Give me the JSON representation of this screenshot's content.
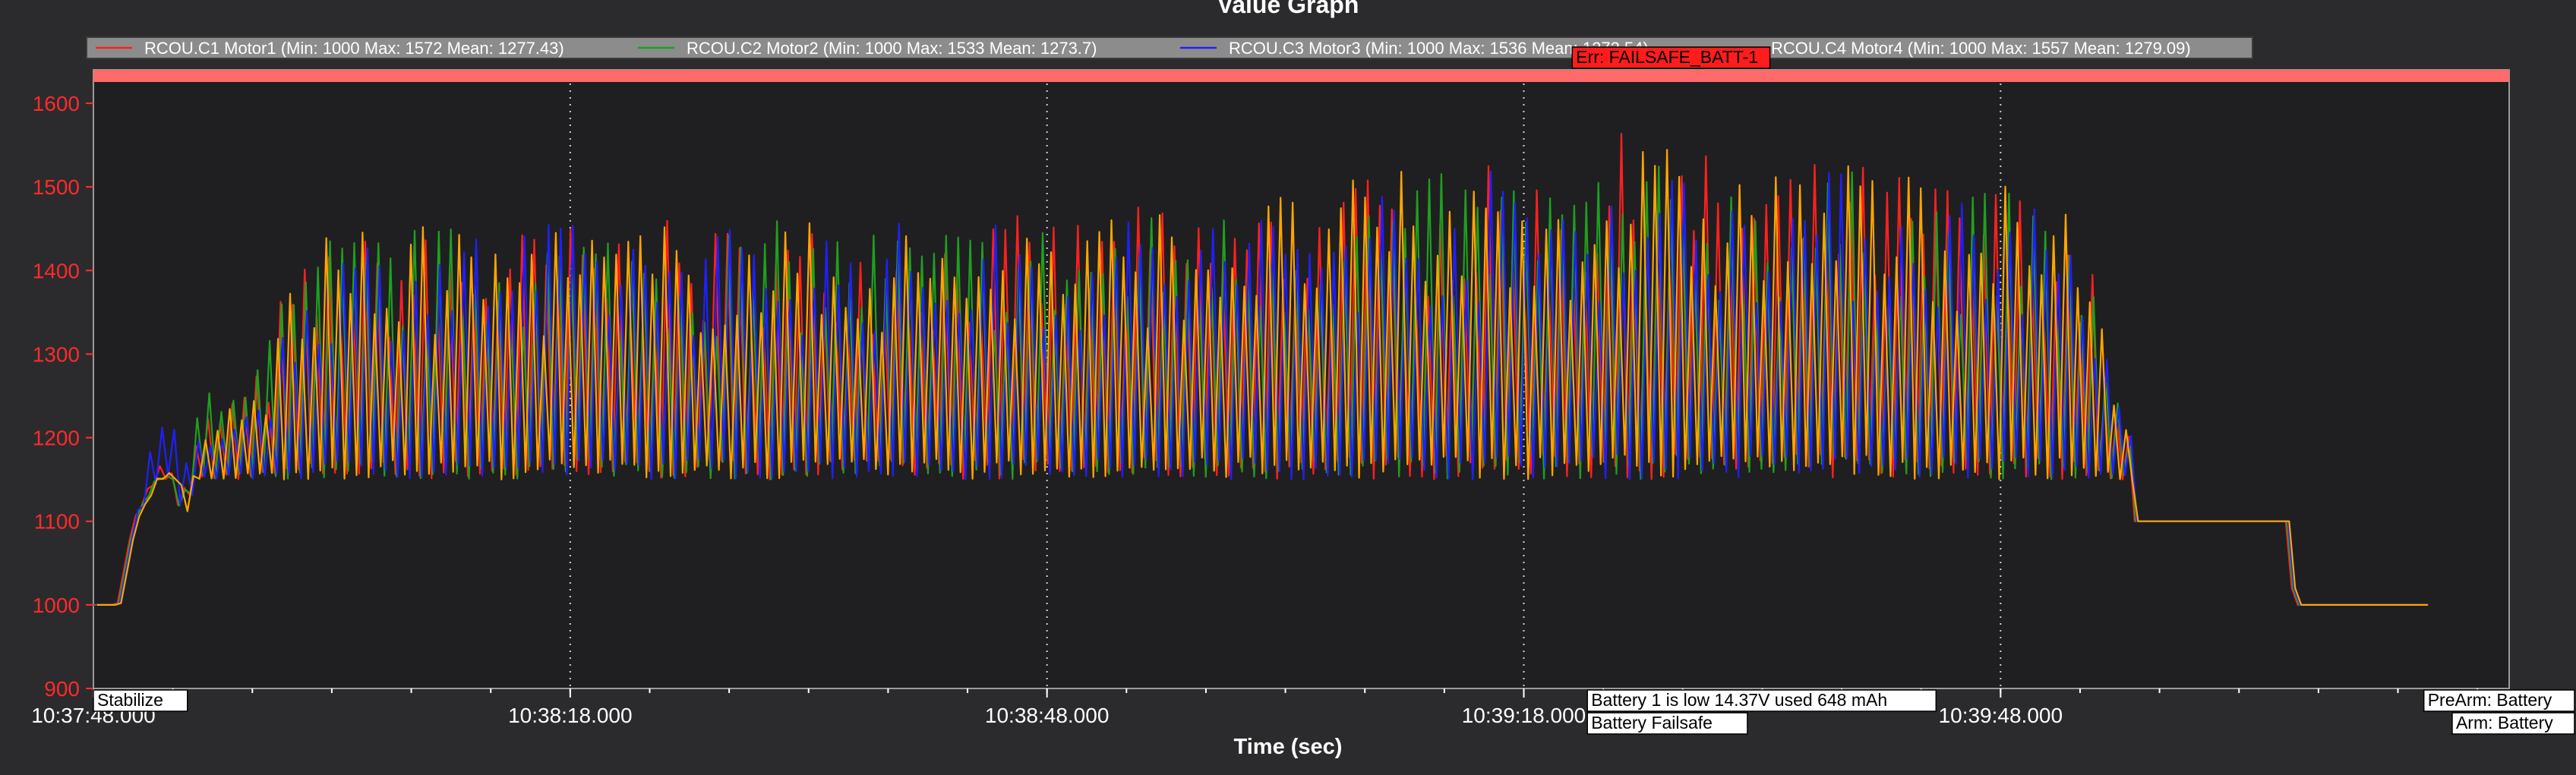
{
  "window": {
    "title": "Value Graph"
  },
  "chart_data": {
    "type": "line",
    "title": "Value Graph",
    "xlabel": "Time (sec)",
    "ylabel": "",
    "x_unit": "time of day",
    "xlim": [
      "10:37:48.000",
      "10:40:20.000"
    ],
    "ylim": [
      900,
      1640
    ],
    "grid": true,
    "legend_position": "top",
    "x_tick_labels": [
      "10:37:48.000",
      "10:38:18.000",
      "10:38:48.000",
      "10:39:18.000",
      "10:39:48.000"
    ],
    "y_tick_labels": [
      "900",
      "1000",
      "1100",
      "1200",
      "1300",
      "1400",
      "1500",
      "1600"
    ],
    "legend": [
      {
        "label": "RCOU.C1 Motor1 (Min: 1000 Max: 1572 Mean: 1277.43)",
        "color": "#ff2020"
      },
      {
        "label": "RCOU.C2 Motor2 (Min: 1000 Max: 1533 Mean: 1273.7)",
        "color": "#1fa01f"
      },
      {
        "label": "RCOU.C3 Motor3 (Min: 1000 Max: 1536 Mean: 1272.54)",
        "color": "#2020ff"
      },
      {
        "label": "RCOU.C4 Motor4 (Min: 1000 Max: 1557 Mean: 1279.09)",
        "color": "#ffa500"
      }
    ],
    "series": [
      {
        "name": "RCOU.C1 Motor1",
        "color": "#ff2020",
        "envelope": {
          "x": [
            "10:37:48.0",
            "10:37:49.5",
            "10:37:50.5",
            "10:37:52.0",
            "10:37:53.0",
            "10:37:53.5",
            "10:37:54.5",
            "10:37:55.5",
            "10:37:58.0",
            "10:37:59.0",
            "10:38:00.0",
            "10:38:03.0",
            "10:38:10.0",
            "10:38:20.0",
            "10:38:30.0",
            "10:38:40.0",
            "10:38:50.0",
            "10:39:00.0",
            "10:39:10.0",
            "10:39:20.0",
            "10:39:25.0",
            "10:39:30.0",
            "10:39:40.0",
            "10:39:50.0",
            "10:39:53.5",
            "10:39:54.5",
            "10:39:55.5",
            "10:39:56.2",
            "10:39:56.4",
            "10:40:06.0",
            "10:40:06.4",
            "10:40:15.0"
          ],
          "min": [
            1000,
            1000,
            1100,
            1150,
            1150,
            1100,
            1150,
            1150,
            1150,
            1150,
            1150,
            1150,
            1150,
            1150,
            1150,
            1150,
            1150,
            1150,
            1150,
            1150,
            1150,
            1150,
            1150,
            1150,
            1150,
            1150,
            1150,
            1150,
            1100,
            1100,
            1000,
            1000
          ],
          "max": [
            1000,
            1000,
            1100,
            1170,
            1160,
            1130,
            1200,
            1240,
            1270,
            1300,
            1390,
            1440,
            1450,
            1460,
            1460,
            1460,
            1470,
            1490,
            1520,
            1530,
            1572,
            1540,
            1530,
            1500,
            1440,
            1300,
            1230,
            1200,
            1100,
            1100,
            1000,
            1000
          ]
        }
      },
      {
        "name": "RCOU.C2 Motor2",
        "color": "#1fa01f",
        "envelope": {
          "x": [
            "10:37:48.0",
            "10:37:49.5",
            "10:37:50.5",
            "10:37:52.0",
            "10:37:53.0",
            "10:37:53.5",
            "10:37:54.5",
            "10:37:55.5",
            "10:37:58.0",
            "10:37:59.0",
            "10:38:00.0",
            "10:38:03.0",
            "10:38:10.0",
            "10:38:20.0",
            "10:38:30.0",
            "10:38:40.0",
            "10:38:50.0",
            "10:39:00.0",
            "10:39:10.0",
            "10:39:20.0",
            "10:39:25.0",
            "10:39:30.0",
            "10:39:40.0",
            "10:39:50.0",
            "10:39:53.5",
            "10:39:54.5",
            "10:39:55.5",
            "10:39:56.2",
            "10:39:56.4",
            "10:40:06.0",
            "10:40:06.4",
            "10:40:15.0"
          ],
          "min": [
            1000,
            1000,
            1100,
            1150,
            1150,
            1100,
            1150,
            1150,
            1150,
            1150,
            1150,
            1150,
            1150,
            1150,
            1150,
            1150,
            1150,
            1150,
            1150,
            1150,
            1150,
            1150,
            1150,
            1150,
            1150,
            1150,
            1150,
            1150,
            1100,
            1100,
            1000,
            1000
          ],
          "max": [
            1000,
            1000,
            1100,
            1160,
            1150,
            1120,
            1240,
            1290,
            1300,
            1330,
            1380,
            1450,
            1455,
            1460,
            1460,
            1460,
            1465,
            1480,
            1510,
            1533,
            1530,
            1525,
            1520,
            1490,
            1430,
            1300,
            1230,
            1200,
            1100,
            1100,
            1000,
            1000
          ]
        }
      },
      {
        "name": "RCOU.C3 Motor3",
        "color": "#2020ff",
        "envelope": {
          "x": [
            "10:37:48.0",
            "10:37:49.5",
            "10:37:50.5",
            "10:37:52.0",
            "10:37:53.0",
            "10:37:53.5",
            "10:37:54.5",
            "10:37:55.5",
            "10:37:58.0",
            "10:37:59.0",
            "10:38:00.0",
            "10:38:03.0",
            "10:38:10.0",
            "10:38:20.0",
            "10:38:30.0",
            "10:38:40.0",
            "10:38:50.0",
            "10:39:00.0",
            "10:39:10.0",
            "10:39:20.0",
            "10:39:25.0",
            "10:39:30.0",
            "10:39:40.0",
            "10:39:50.0",
            "10:39:53.5",
            "10:39:54.5",
            "10:39:55.5",
            "10:39:56.2",
            "10:39:56.4",
            "10:40:06.0",
            "10:40:06.4",
            "10:40:15.0"
          ],
          "min": [
            1000,
            1000,
            1100,
            1150,
            1150,
            1100,
            1150,
            1150,
            1150,
            1150,
            1150,
            1150,
            1150,
            1150,
            1150,
            1150,
            1150,
            1150,
            1150,
            1150,
            1150,
            1150,
            1150,
            1150,
            1150,
            1150,
            1150,
            1150,
            1100,
            1100,
            1000,
            1000
          ],
          "max": [
            1000,
            1000,
            1100,
            1240,
            1230,
            1160,
            1210,
            1220,
            1250,
            1280,
            1350,
            1445,
            1455,
            1460,
            1460,
            1460,
            1465,
            1480,
            1515,
            1530,
            1536,
            1530,
            1520,
            1495,
            1430,
            1300,
            1230,
            1200,
            1100,
            1100,
            1000,
            1000
          ]
        }
      },
      {
        "name": "RCOU.C4 Motor4",
        "color": "#ffa500",
        "envelope": {
          "x": [
            "10:37:48.0",
            "10:37:49.5",
            "10:37:50.5",
            "10:37:52.0",
            "10:37:53.0",
            "10:37:53.5",
            "10:37:54.5",
            "10:37:55.5",
            "10:37:58.0",
            "10:37:59.0",
            "10:38:00.0",
            "10:38:03.0",
            "10:38:10.0",
            "10:38:20.0",
            "10:38:30.0",
            "10:38:40.0",
            "10:38:50.0",
            "10:39:00.0",
            "10:39:10.0",
            "10:39:20.0",
            "10:39:25.0",
            "10:39:30.0",
            "10:39:40.0",
            "10:39:50.0",
            "10:39:53.5",
            "10:39:54.5",
            "10:39:55.5",
            "10:39:56.2",
            "10:39:56.4",
            "10:40:06.0",
            "10:40:06.4",
            "10:40:15.0"
          ],
          "min": [
            1000,
            1000,
            1100,
            1150,
            1150,
            1100,
            1150,
            1150,
            1150,
            1150,
            1150,
            1150,
            1150,
            1150,
            1150,
            1150,
            1150,
            1150,
            1150,
            1150,
            1150,
            1150,
            1150,
            1150,
            1150,
            1150,
            1150,
            1150,
            1100,
            1100,
            1000,
            1000
          ],
          "max": [
            1000,
            1000,
            1100,
            1160,
            1160,
            1140,
            1190,
            1230,
            1260,
            1290,
            1400,
            1450,
            1455,
            1460,
            1460,
            1460,
            1470,
            1490,
            1520,
            1530,
            1557,
            1540,
            1530,
            1500,
            1440,
            1300,
            1230,
            1200,
            1100,
            1100,
            1000,
            1000
          ]
        }
      }
    ],
    "annotations": [
      {
        "text": "Stabilize",
        "x": "10:37:48.000",
        "placement": "bottom"
      },
      {
        "text": "Battery 1 is low 14.37V used 648 mAh",
        "x": "10:39:22.000",
        "placement": "bottom"
      },
      {
        "text": "Battery Failsafe",
        "x": "10:39:22.000",
        "placement": "bottom"
      },
      {
        "text": "PreArm: Battery",
        "x": "10:40:16.000",
        "placement": "bottom"
      },
      {
        "text": "Arm: Battery",
        "x": "10:40:17.000",
        "placement": "bottom"
      },
      {
        "text": "Err: FAILSAFE_BATT-1",
        "x": "10:39:22.000",
        "placement": "top"
      }
    ]
  }
}
